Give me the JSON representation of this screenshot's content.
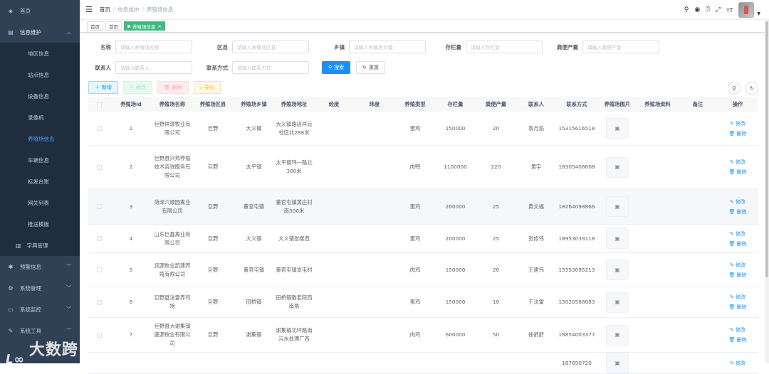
{
  "sidebar": {
    "items": [
      {
        "label": "首页",
        "icon": "dashboard-icon"
      },
      {
        "label": "信息维护",
        "icon": "document-icon",
        "expanded": true
      }
    ],
    "sub": [
      "地区信息",
      "站点信息",
      "设备信息",
      "录像机",
      "养殖场信息",
      "车辆信息",
      "标发台账",
      "网关列表",
      "推送模版"
    ],
    "dict": "字典管理",
    "bottom": [
      "预警信息",
      "系统管理",
      "系统监控",
      "系统工具"
    ]
  },
  "watermark": "大数跨境",
  "navbar": {
    "breadcrumb": [
      "首页",
      "信息维护",
      "养殖场信息"
    ]
  },
  "tags": [
    "首页",
    "首页",
    "养殖场信息"
  ],
  "form": {
    "row1": [
      {
        "label": "名称",
        "placeholder": "请输入养殖场名称"
      },
      {
        "label": "区县",
        "placeholder": "请输入养殖场区县"
      },
      {
        "label": "乡镇",
        "placeholder": "请输入养殖场乡镇"
      },
      {
        "label": "存栏量",
        "placeholder": "请输入存栏量"
      },
      {
        "label": "粪便产量",
        "placeholder": "请输入粪便产量"
      }
    ],
    "row2": [
      {
        "label": "联系人",
        "placeholder": "请输入联系人"
      },
      {
        "label": "联系方式",
        "placeholder": "请输入联系方式"
      }
    ],
    "search": "搜索",
    "reset": "重置"
  },
  "toolbar": {
    "add": "新增",
    "edit": "修改",
    "delete": "删除",
    "export": "导出"
  },
  "table": {
    "headers": [
      "养殖场id",
      "养殖场名称",
      "养殖场区县",
      "养殖场乡镇",
      "养殖场地址",
      "经度",
      "纬度",
      "养殖类型",
      "存栏量",
      "粪便产量",
      "联系人",
      "联系方式",
      "养殖场图片",
      "养殖场资料",
      "备注",
      "操作"
    ],
    "edit": "修改",
    "delete": "删除",
    "rows": [
      {
        "id": "1",
        "name": "巨野祥源牧业有限公司",
        "county": "巨野",
        "town": "大义镇",
        "addr": "大义镇路店祥云社区北288米",
        "type": "蛋鸡",
        "stock": "150000",
        "manure": "20",
        "contact": "袁月焰",
        "phone": "15315616518"
      },
      {
        "id": "2",
        "name": "巨野县兴邦养殖技术咨询服务有限公司",
        "county": "巨野",
        "town": "太平镇",
        "addr": "太平镇玮一路北300米",
        "type": "肉鸭",
        "stock": "1100000",
        "manure": "220",
        "contact": "黄宇",
        "phone": "18305408608"
      },
      {
        "id": "3",
        "name": "菏泽六顺园禽业有限公司",
        "county": "巨野",
        "town": "董官屯镇",
        "addr": "董官屯镇黄庄村南300米",
        "type": "蛋鸡",
        "stock": "200000",
        "manure": "25",
        "contact": "黄文福",
        "phone": "18264098866"
      },
      {
        "id": "4",
        "name": "山东巨鑫禽业有限公司",
        "county": "巨野",
        "town": "大义镇",
        "addr": "大义镇张楼西",
        "type": "蛋鸡",
        "stock": "200000",
        "manure": "25",
        "contact": "张修伟",
        "phone": "18953039118"
      },
      {
        "id": "5",
        "name": "润源牧业凯建养殖有限公司",
        "county": "巨野",
        "town": "董官屯镇",
        "addr": "董官屯镇支屯村",
        "type": "肉鸡",
        "stock": "150000",
        "manure": "20",
        "contact": "王建伟",
        "phone": "15553095213"
      },
      {
        "id": "6",
        "name": "巨野县法雷养鸡场",
        "county": "巨野",
        "town": "田桥镇",
        "addr": "田桥镇敬老院西南角",
        "type": "蛋鸡",
        "stock": "150000",
        "manure": "10",
        "contact": "于法雷",
        "phone": "15020568083"
      },
      {
        "id": "7",
        "name": "巨野县大谢集镇盛源牧业有限公司",
        "county": "巨野",
        "town": "谢集镇",
        "addr": "谢集镇北环路南污水处理厂西",
        "type": "肉鸡",
        "stock": "600000",
        "manure": "50",
        "contact": "徐舒舒",
        "phone": "18854003377"
      },
      {
        "id": "",
        "name": "",
        "county": "",
        "town": "",
        "addr": "",
        "type": "",
        "stock": "",
        "manure": "",
        "contact": "",
        "phone": "187690720"
      }
    ]
  }
}
